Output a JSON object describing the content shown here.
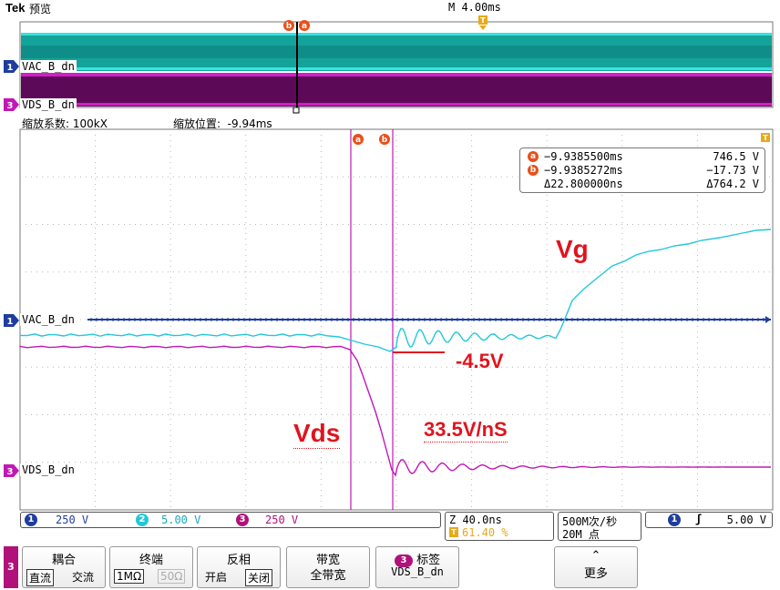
{
  "header": {
    "brand": "Tek",
    "mode": "预览",
    "time_base": "M 4.00ms",
    "zoom_factor": "缩放系数: 100kX",
    "zoom_position": "缩放位置:  -9.94ms"
  },
  "channels": {
    "ch1": {
      "number": "1",
      "label": "VAC_B_dn",
      "scale": "250 V",
      "color": "#1f3d9e"
    },
    "ch2": {
      "number": "2",
      "label": "",
      "scale": "5.00 V",
      "color": "#22c7d9"
    },
    "ch3": {
      "number": "3",
      "label": "VDS_B_dn",
      "scale": "250 V",
      "color": "#c018b5"
    }
  },
  "cursors": {
    "a": {
      "marker": "a",
      "time": "−9.9385500ms",
      "value": "746.5 V"
    },
    "b": {
      "marker": "b",
      "time": "−9.9385272ms",
      "value": "−17.73 V"
    },
    "delta": {
      "time": "Δ22.800000ns",
      "value": "Δ764.2 V"
    }
  },
  "trigger": {
    "marker": "T"
  },
  "annotations": {
    "vg": "Vg",
    "vds": "Vds",
    "neg_voltage": "-4.5V",
    "slew": "33.5V/nS"
  },
  "status": {
    "zoom_time": "Z 40.0ns",
    "trigger_pos": "61.40 %",
    "sample_rate": "500M次/秒",
    "record_length": "20M 点",
    "trig_channel": "1",
    "trig_slope": "ʃ",
    "trig_level": "5.00 V"
  },
  "menu": {
    "channel": "3",
    "coupling": {
      "title": "耦合",
      "dc": "直流",
      "ac": "交流"
    },
    "termination": {
      "title": "终端",
      "one_meg": "1MΩ",
      "fifty": "50Ω"
    },
    "invert": {
      "title": "反相",
      "on": "开启",
      "off": "关闭"
    },
    "bandwidth": {
      "title": "带宽",
      "value": "全带宽"
    },
    "label": {
      "title": "标签",
      "value": "VDS_B_dn",
      "badge": "3"
    },
    "more": {
      "arrow": "⌃",
      "title": "更多"
    }
  },
  "colors": {
    "cyan": "#22c7d9",
    "magenta": "#c018b5",
    "navy": "#1f3d9e",
    "cursor_marker": "#e8501a",
    "annotation": "#e0141e"
  }
}
